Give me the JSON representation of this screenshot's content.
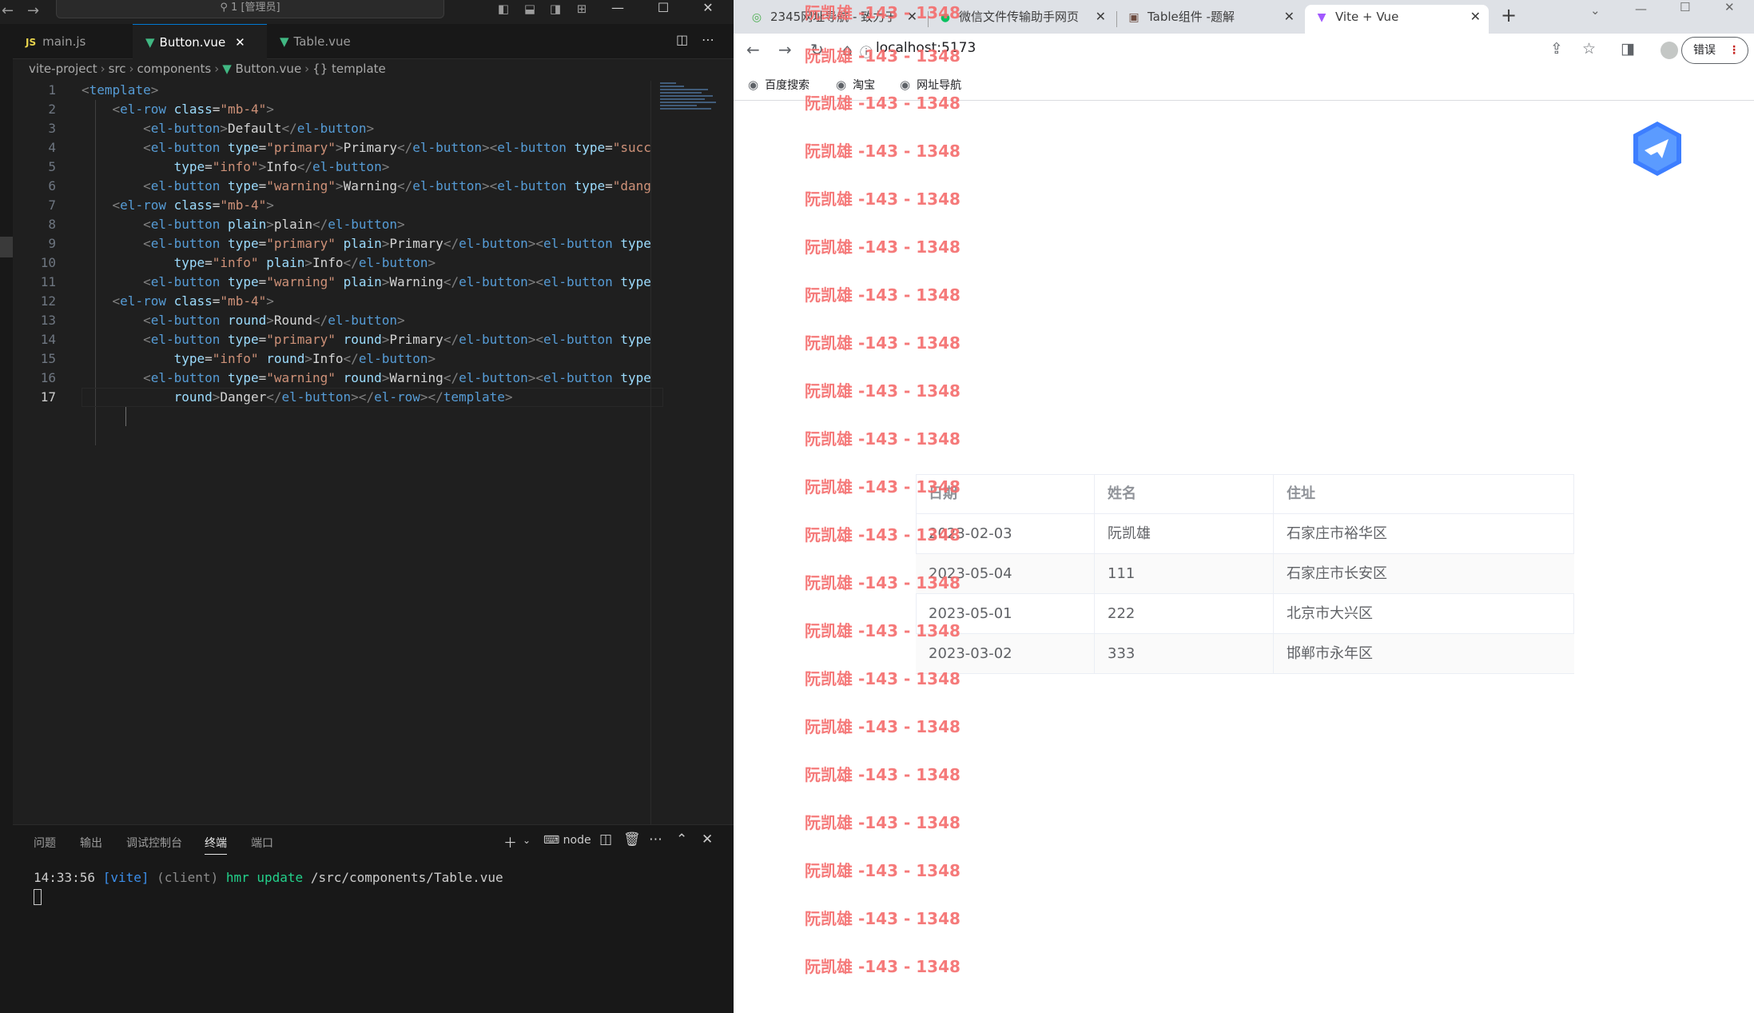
{
  "vscode": {
    "command_center": "1 [管理员]",
    "tabs": [
      {
        "label": "main.js",
        "icon": "js-icon"
      },
      {
        "label": "Button.vue",
        "icon": "vue-icon"
      },
      {
        "label": "Table.vue",
        "icon": "vue-icon"
      }
    ],
    "breadcrumb": [
      "vite-project",
      "src",
      "components",
      "Button.vue",
      "{} template"
    ],
    "code_lines": [
      "1",
      "2",
      "3",
      "4",
      "5",
      "6",
      "7",
      "8",
      "9",
      "10",
      "11",
      "12",
      "13",
      "14",
      "15",
      "16",
      "17"
    ],
    "panel_tabs": [
      "问题",
      "输出",
      "调试控制台",
      "终端",
      "端口"
    ],
    "terminal_profile": "node",
    "terminal": {
      "time": "14:33:56",
      "tag": "[vite]",
      "scope": "(client)",
      "action": "hmr update",
      "path": "/src/components/Table.vue"
    }
  },
  "browser": {
    "tabs": [
      {
        "label": "2345网址导航 - 致力于",
        "icon": "globe-icon"
      },
      {
        "label": "微信文件传输助手网页",
        "icon": "wechat-icon"
      },
      {
        "label": "Table组件 -题解",
        "icon": "page-icon"
      },
      {
        "label": "Vite + Vue",
        "icon": "vite-icon"
      }
    ],
    "url": "localhost:5173",
    "error_button": "错误",
    "bookmarks": [
      "百度搜索",
      "淘宝",
      "网址导航"
    ],
    "watermark": "阮凯雄 -143 - 1348",
    "table": {
      "headers": [
        "日期",
        "姓名",
        "住址"
      ],
      "rows": [
        [
          "2023-02-03",
          "阮凯雄",
          "石家庄市裕华区"
        ],
        [
          "2023-05-04",
          "111",
          "石家庄市长安区"
        ],
        [
          "2023-05-01",
          "222",
          "北京市大兴区"
        ],
        [
          "2023-03-02",
          "333",
          "邯郸市永年区"
        ]
      ]
    }
  }
}
